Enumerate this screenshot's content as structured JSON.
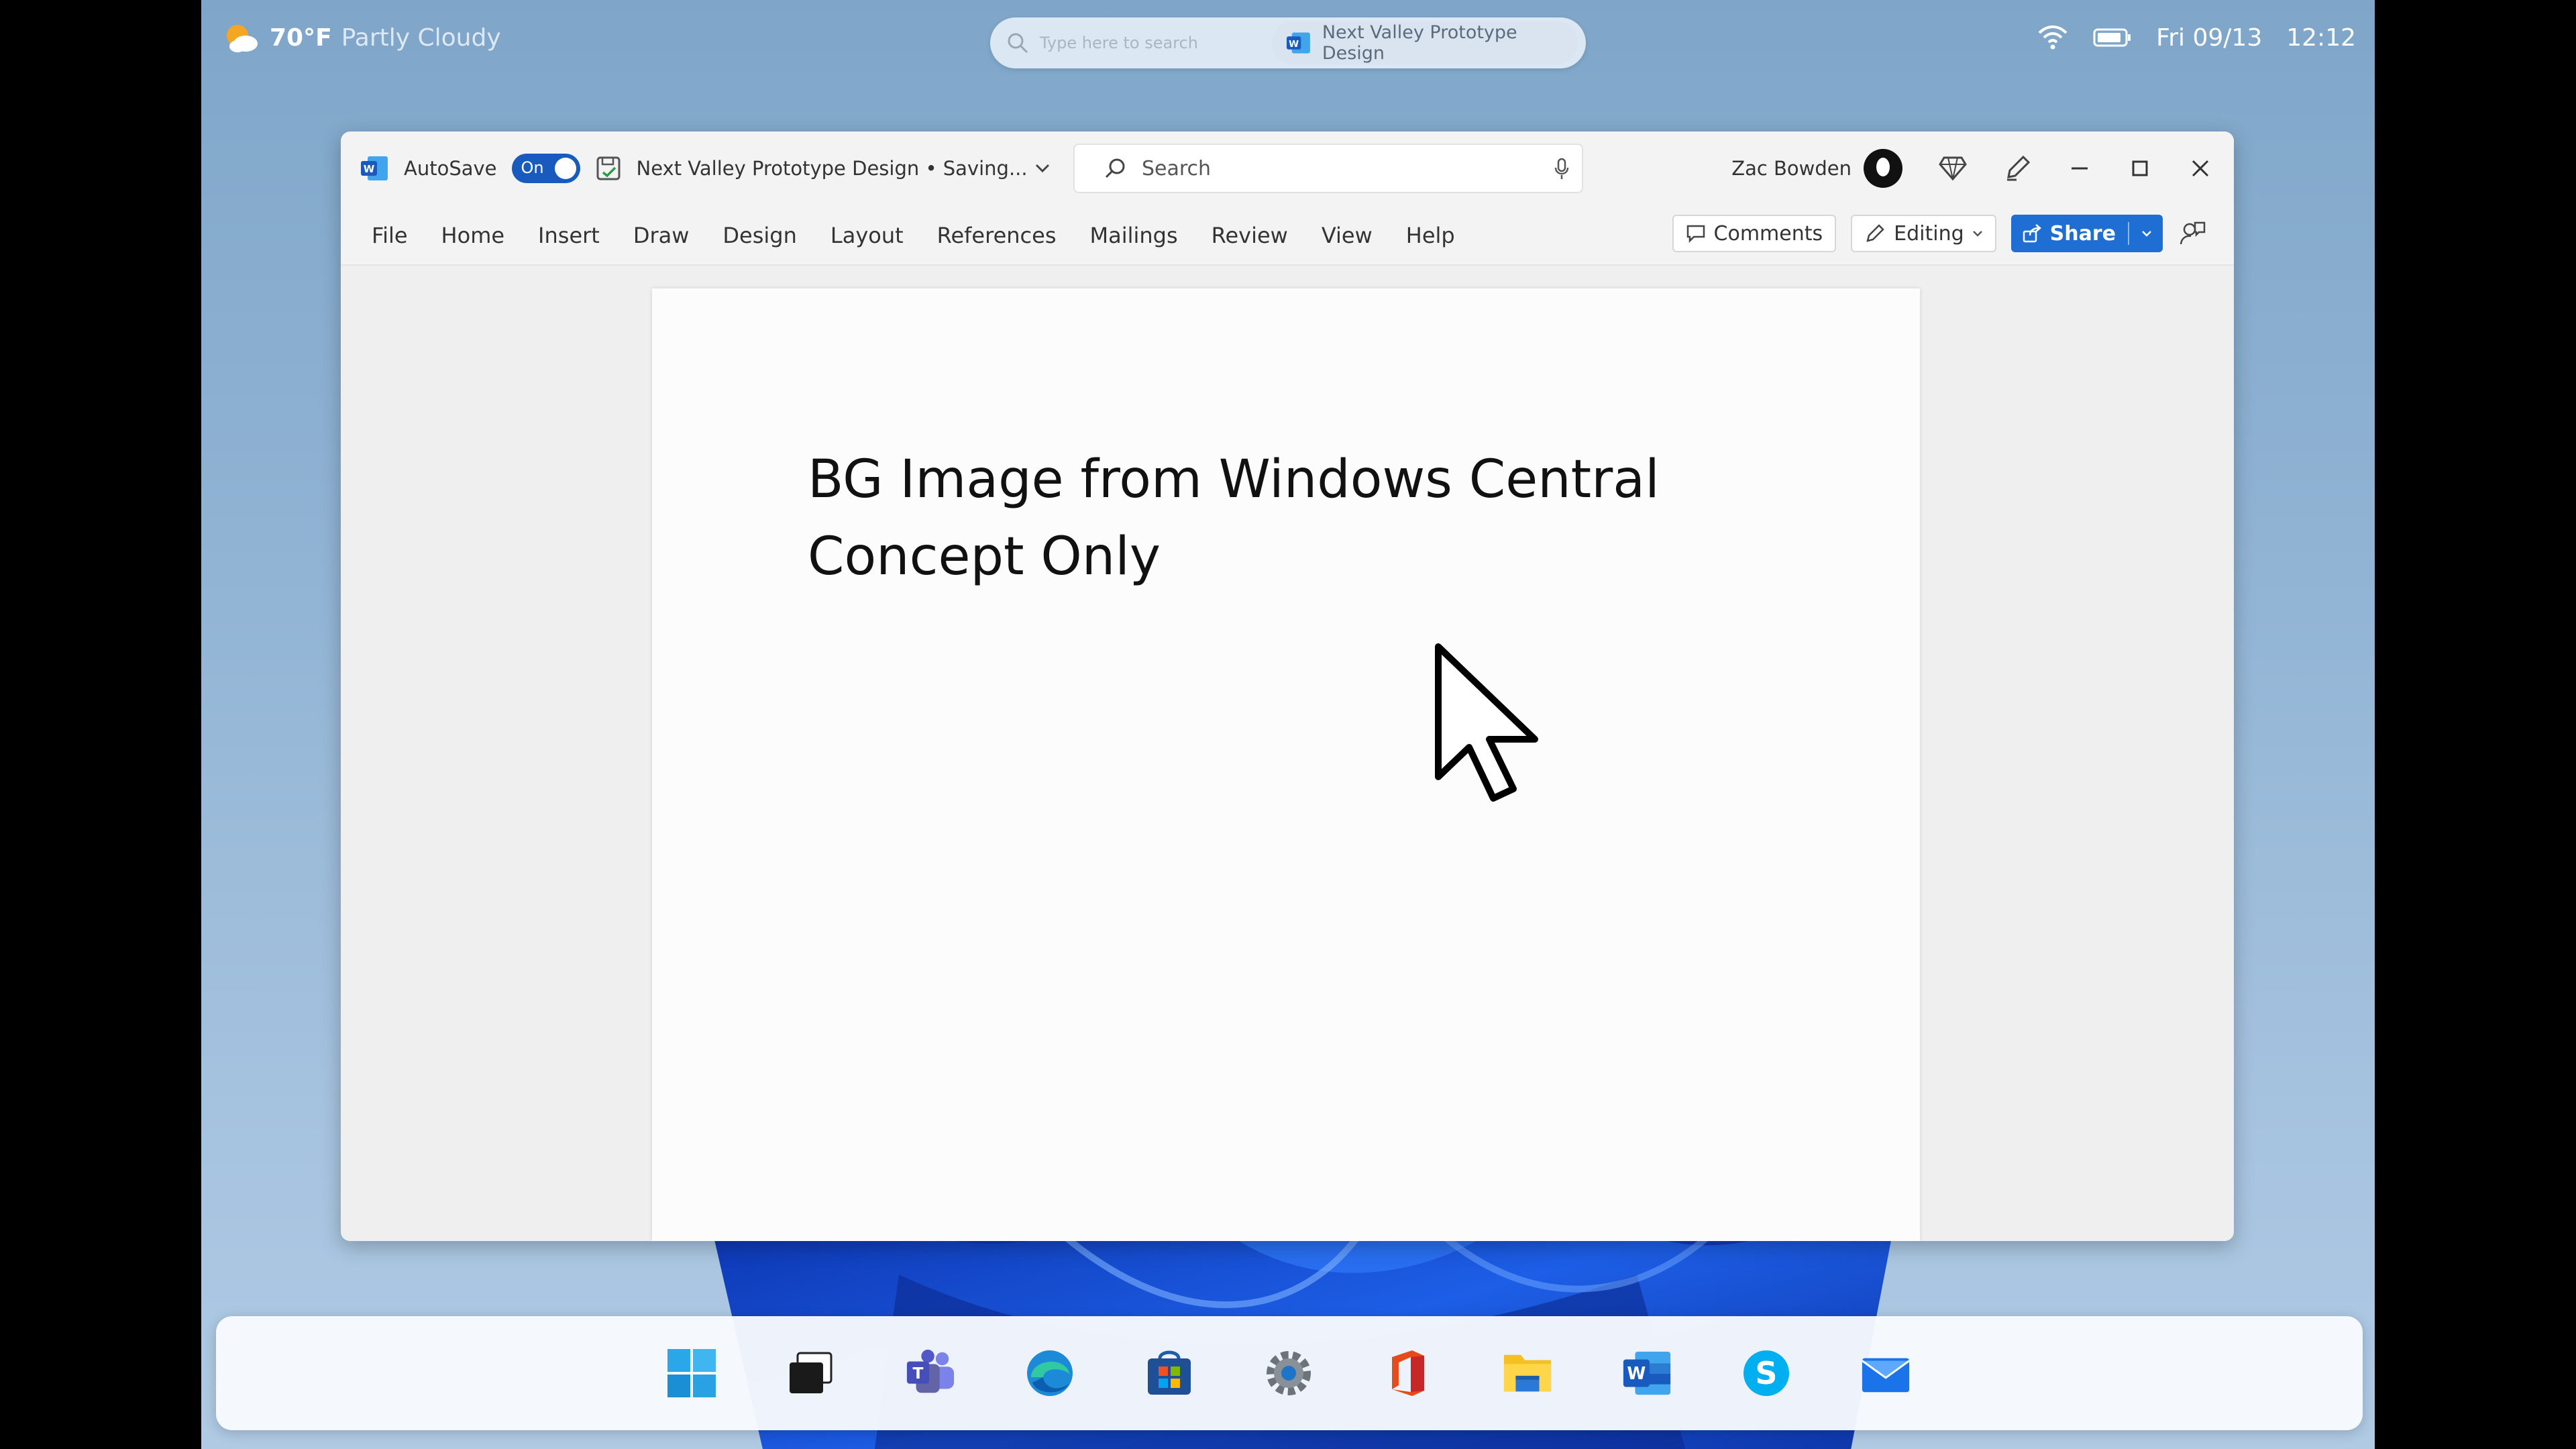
{
  "status_bar": {
    "weather_temp": "70°F",
    "weather_condition": "Partly Cloudy",
    "search_placeholder": "Type here to search",
    "active_doc": "Next Valley Prototype Design",
    "date": "Fri 09/13",
    "time": "12:12"
  },
  "word": {
    "autosave_label": "AutoSave",
    "autosave_state": "On",
    "doc_title": "Next Valley Prototype Design • Saving...",
    "search_placeholder": "Search",
    "user_name": "Zac Bowden",
    "tabs": [
      "File",
      "Home",
      "Insert",
      "Draw",
      "Design",
      "Layout",
      "References",
      "Mailings",
      "Review",
      "View",
      "Help"
    ],
    "comments_label": "Comments",
    "editing_label": "Editing",
    "share_label": "Share",
    "document": {
      "line1": "BG Image from Windows Central",
      "line2": "Concept Only"
    }
  },
  "taskbar": {
    "apps": [
      "start-icon",
      "task-view-icon",
      "teams-icon",
      "edge-icon",
      "store-icon",
      "settings-icon",
      "office-icon",
      "file-explorer-icon",
      "word-icon",
      "skype-icon",
      "mail-icon"
    ]
  },
  "colors": {
    "word_blue": "#185abd",
    "share_blue": "#1f6ed4",
    "wallpaper": "#8fb2d3",
    "bloom_blue": "#1c4fd8"
  }
}
